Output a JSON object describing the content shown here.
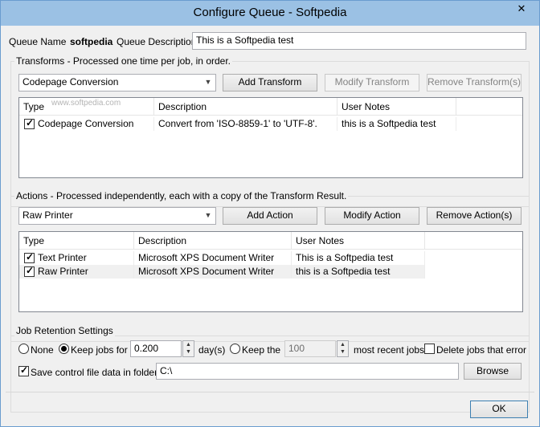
{
  "window": {
    "title": "Configure Queue - Softpedia",
    "close_glyph": "✕"
  },
  "queue": {
    "name_label": "Queue Name",
    "name_value": "softpedia",
    "description_label": "Queue Description",
    "description_value": "This is a Softpedia test"
  },
  "transforms": {
    "group_title": "Transforms - Processed one time per job, in order.",
    "combo_value": "Codepage Conversion",
    "add_label": "Add Transform",
    "modify_label": "Modify Transform",
    "remove_label": "Remove Transform(s)",
    "columns": [
      "Type",
      "Description",
      "User Notes"
    ],
    "rows": [
      {
        "type": "Codepage Conversion",
        "description": "Convert from 'ISO-8859-1' to 'UTF-8'.",
        "notes": "this is a Softpedia test",
        "checked": true
      }
    ],
    "watermark": "www.softpedia.com"
  },
  "actions": {
    "group_title": "Actions - Processed independently, each with a copy of the Transform Result.",
    "combo_value": "Raw Printer",
    "add_label": "Add Action",
    "modify_label": "Modify Action",
    "remove_label": "Remove Action(s)",
    "columns": [
      "Type",
      "Description",
      "User Notes"
    ],
    "rows": [
      {
        "type": "Text Printer",
        "description": "Microsoft XPS Document Writer",
        "notes": "This is a Softpedia test",
        "checked": true
      },
      {
        "type": "Raw Printer",
        "description": "Microsoft XPS Document Writer",
        "notes": "this is a Softpedia test",
        "checked": true
      }
    ]
  },
  "retention": {
    "group_title": "Job Retention Settings",
    "none_label": "None",
    "keep_jobs_label": "Keep jobs for",
    "days_value": "0.200",
    "days_label": "day(s)",
    "keep_the_label": "Keep the",
    "recent_value": "100",
    "recent_label": "most recent jobs",
    "delete_error_label": "Delete jobs that error",
    "save_control_label": "Save control file data in folder:",
    "folder_value": "C:\\",
    "browse_label": "Browse"
  },
  "footer": {
    "ok_label": "OK"
  }
}
